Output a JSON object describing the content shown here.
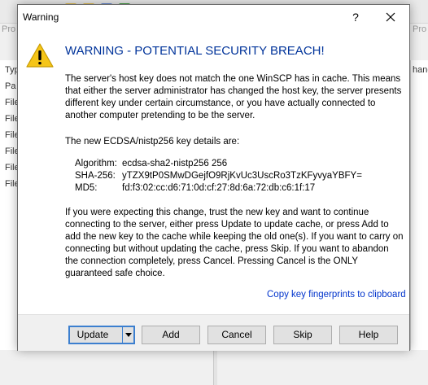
{
  "background": {
    "left_rows": [
      "Typ",
      "Pa",
      "File",
      "File",
      "File",
      "File",
      "File",
      "File"
    ],
    "prop_labels": [
      "Pro",
      "Pro"
    ],
    "right_text": "hang"
  },
  "dialog": {
    "title": "Warning",
    "help_glyph": "?",
    "headline": "WARNING - POTENTIAL SECURITY BREACH!",
    "paragraph1": "The server's host key does not match the one WinSCP has in cache. This means that either the server administrator has changed the host key, the server presents different key under certain circumstance, or you have actually connected to another computer pretending to be the server.",
    "paragraph2": "The new ECDSA/nistp256 key details are:",
    "key_details": [
      {
        "label": "Algorithm:",
        "value": "ecdsa-sha2-nistp256 256"
      },
      {
        "label": "SHA-256:",
        "value": "yTZX9tP0SMwDGejfO9RjKvUc3UscRo3TzKFyvyaYBFY="
      },
      {
        "label": "MD5:",
        "value": "fd:f3:02:cc:d6:71:0d:cf:27:8d:6a:72:db:c6:1f:17"
      }
    ],
    "paragraph3": "If you were expecting this change, trust the new key and want to continue connecting to the server, either press Update to update cache, or press Add to add the new key to the cache while keeping the old one(s). If you want to carry on connecting but without updating the cache, press Skip. If you want to abandon the connection completely, press Cancel. Pressing Cancel is the ONLY guaranteed safe choice.",
    "copy_link": "Copy key fingerprints to clipboard",
    "buttons": {
      "update": "Update",
      "add": "Add",
      "cancel": "Cancel",
      "skip": "Skip",
      "help": "Help"
    }
  },
  "colors": {
    "headline": "#00339a",
    "link": "#0033cc",
    "default_button_border": "#3c7fcf",
    "warning_yellow": "#f5c518"
  }
}
